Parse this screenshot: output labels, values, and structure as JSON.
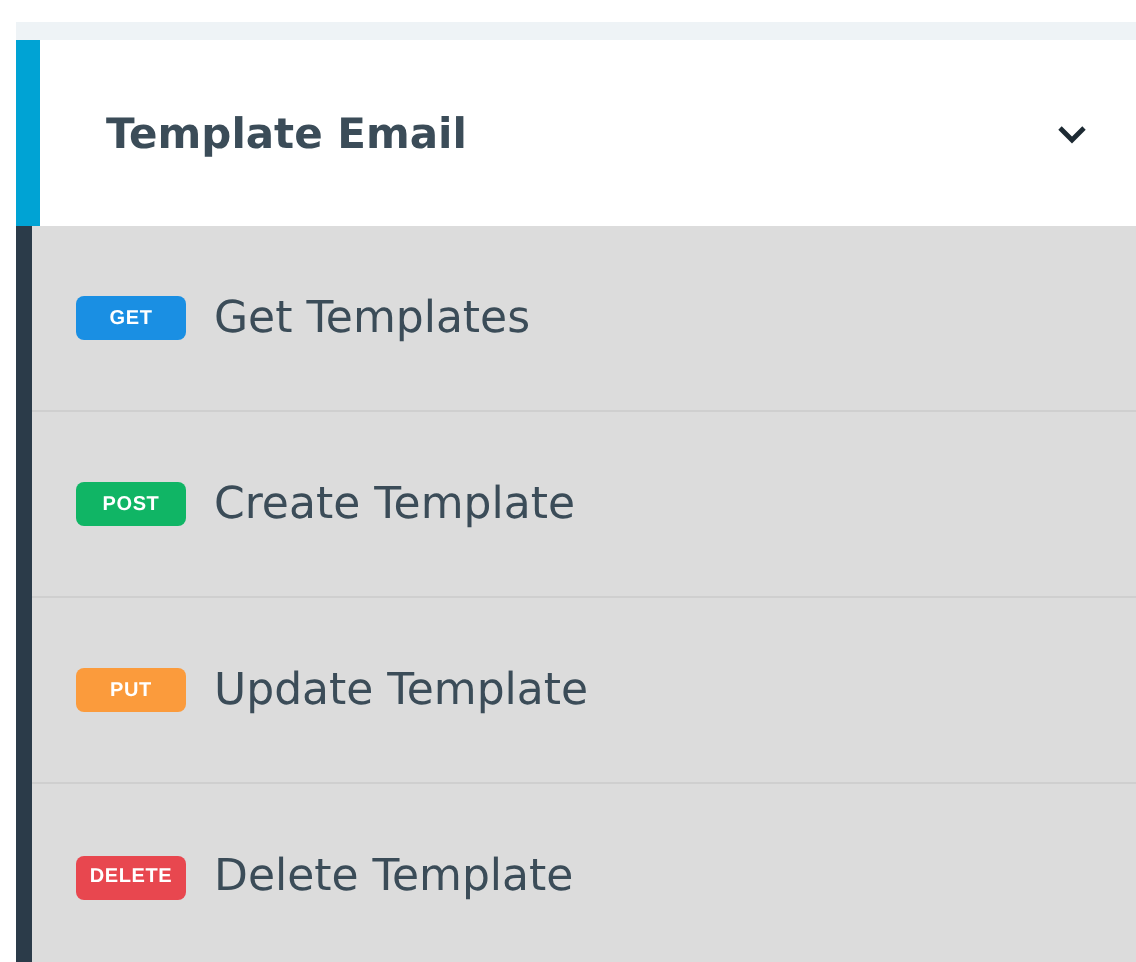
{
  "group": {
    "title": "Template Email",
    "expanded": true
  },
  "endpoints": [
    {
      "method": "GET",
      "color": "#1a8fe3",
      "label": "Get Templates"
    },
    {
      "method": "POST",
      "color": "#10b565",
      "label": "Create Template"
    },
    {
      "method": "PUT",
      "color": "#fb9b3c",
      "label": "Update Template"
    },
    {
      "method": "DELETE",
      "color": "#e8474f",
      "label": "Delete Template"
    }
  ]
}
